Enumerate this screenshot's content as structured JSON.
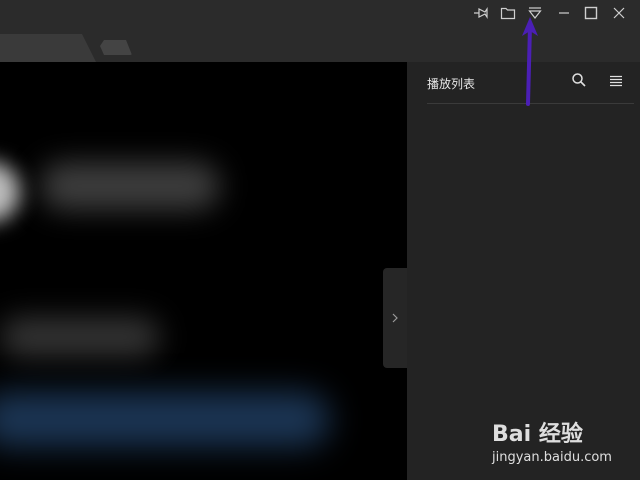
{
  "titlebar": {
    "icons": [
      "pin-icon",
      "open-folder-icon",
      "dropdown-menu-icon",
      "minimize-icon",
      "maximize-icon",
      "close-icon"
    ]
  },
  "playlist": {
    "title": "播放列表",
    "icons": [
      "search-icon",
      "list-menu-icon"
    ]
  },
  "watermark": {
    "logo": "Bai 经验",
    "url": "jingyan.baidu.com"
  },
  "colors": {
    "annotation_arrow": "#4b1fb5",
    "background": "#262626",
    "video_area": "#000000"
  }
}
